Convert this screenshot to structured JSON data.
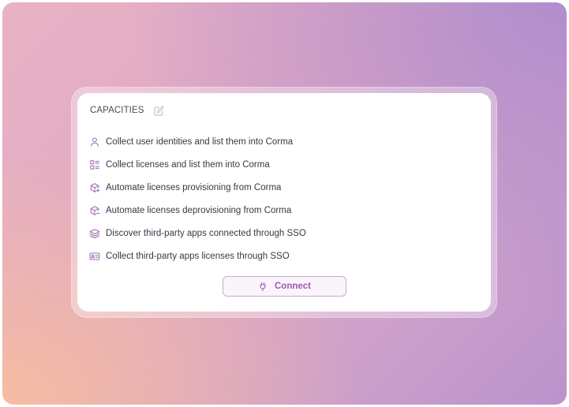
{
  "capacities": {
    "title": "CAPACITIES",
    "edit_icon": "edit-icon",
    "items": [
      {
        "icon": "user-icon",
        "label": "Collect user identities and list them into Corma"
      },
      {
        "icon": "list-icon",
        "label": "Collect licenses and list them into Corma"
      },
      {
        "icon": "box-add-icon",
        "label": "Automate licenses provisioning from Corma"
      },
      {
        "icon": "box-remove-icon",
        "label": "Automate licenses deprovisioning from Corma"
      },
      {
        "icon": "layers-icon",
        "label": "Discover third-party apps connected through SSO"
      },
      {
        "icon": "id-card-icon",
        "label": "Collect third-party apps licenses through SSO"
      }
    ]
  },
  "connect_button": {
    "label": "Connect",
    "icon": "plug-icon"
  },
  "colors": {
    "accent": "#9a5ab0",
    "icon": "#a77ab8",
    "text": "#3b3646"
  }
}
